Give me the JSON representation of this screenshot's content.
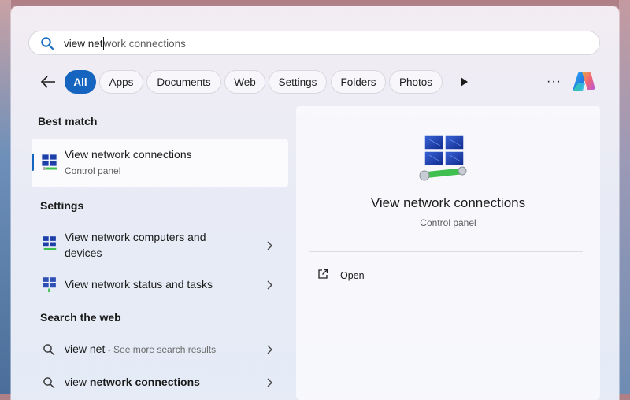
{
  "search": {
    "typed": "view net",
    "completion": "work connections"
  },
  "filters": {
    "items": [
      {
        "label": "All",
        "active": true
      },
      {
        "label": "Apps"
      },
      {
        "label": "Documents"
      },
      {
        "label": "Web"
      },
      {
        "label": "Settings"
      },
      {
        "label": "Folders"
      },
      {
        "label": "Photos"
      }
    ],
    "more_label": "···"
  },
  "best_match": {
    "heading": "Best match",
    "title": "View network connections",
    "subtitle": "Control panel"
  },
  "settings": {
    "heading": "Settings",
    "items": [
      {
        "title_line1": "View network computers and",
        "title_line2": "devices"
      },
      {
        "title_line1": "View network status and tasks"
      }
    ]
  },
  "web": {
    "heading": "Search the web",
    "items": [
      {
        "query": "view net",
        "hint": " - See more search results"
      },
      {
        "query_prefix": "view ",
        "query_bold": "network connections"
      }
    ]
  },
  "preview": {
    "title": "View network connections",
    "subtitle": "Control panel",
    "actions": [
      {
        "label": "Open"
      }
    ]
  },
  "colors": {
    "accent": "#1565c0"
  }
}
